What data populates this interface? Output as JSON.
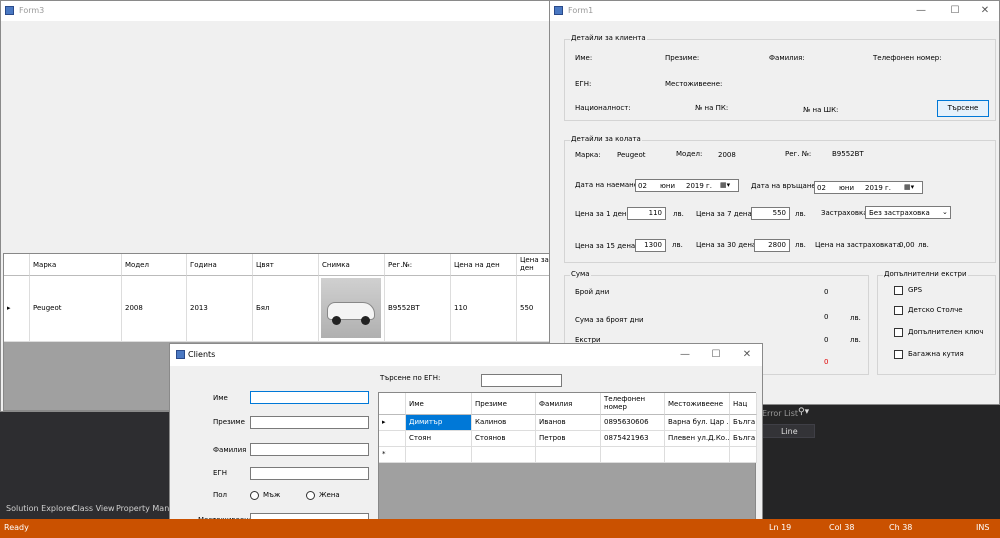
{
  "form3": {
    "title": "Form3",
    "grid": {
      "headers": [
        "Марка",
        "Модел",
        "Година",
        "Цвят",
        "Снимка",
        "Рег.№:",
        "Цена на ден",
        "Цена за ден"
      ],
      "row": [
        "Peugeot",
        "2008",
        "2013",
        "Бял",
        "",
        "B9552BT",
        "110",
        "550"
      ]
    }
  },
  "form1": {
    "title": "Form1",
    "client_group": "Детайли за клиента",
    "labels": {
      "ime": "Име:",
      "prezime": "Презиме:",
      "familia": "Фамилия:",
      "tel": "Телефонен номер:",
      "egn": "ЕГН:",
      "mestozhiveene": "Местоживеене:",
      "nacionalnost": "Националност:",
      "pk": "№ на ПК:",
      "shk": "№ на ШК:"
    },
    "search_button": "Търсене",
    "car_group": "Детайли за колата",
    "car": {
      "marka_label": "Марка:",
      "marka_value": "Peugeot",
      "model_label": "Модел:",
      "model_value": "2008",
      "reg_label": "Рег. №:",
      "reg_value": "B9552BT"
    },
    "dates": {
      "rent_label": "Дата на наемане",
      "rent_day": "02",
      "rent_month": "юни",
      "rent_year": "2019 г.",
      "return_label": "Дата на връщане",
      "return_day": "02",
      "return_month": "юни",
      "return_year": "2019 г."
    },
    "prices": {
      "p1_label": "Цена за 1 ден",
      "p1_value": "110",
      "p7_label": "Цена за 7 дена",
      "p7_value": "550",
      "p15_label": "Цена за 15 дена",
      "p15_value": "1300",
      "p30_label": "Цена за 30 дена",
      "p30_value": "2800",
      "currency": "лв.",
      "insurance_label": "Застраховка",
      "insurance_value": "Без застраховка",
      "insurance_price_label": "Цена на застраховката",
      "insurance_price_value": "0,00",
      "insurance_currency": "лв."
    },
    "sum_group": "Сума",
    "sum": {
      "days_label": "Брой дни",
      "days_value": "0",
      "sum_days_label": "Сума за броят дни",
      "sum_days_value": "0",
      "sum_days_currency": "лв.",
      "extras_label": "Екстри",
      "extras_value": "0",
      "extras_currency": "лв.",
      "total_value": "0"
    },
    "extras_group": "Допълнителни екстри",
    "extras": [
      "GPS",
      "Детско Столче",
      "Допълнителен ключ",
      "Багажна кутия"
    ]
  },
  "clients": {
    "title": "Clients",
    "search_label": "Търсене по ЕГН:",
    "fields": {
      "ime": "Име",
      "prezime": "Презиме",
      "familia": "Фамилия",
      "egn": "ЕГН",
      "pol": "Пол",
      "male": "Мъж",
      "female": "Жена",
      "mestozhiveene": "Местоживеене"
    },
    "grid": {
      "headers": [
        "Име",
        "Презиме",
        "Фамилия",
        "Телефонен номер",
        "Местоживеене",
        "Нац"
      ],
      "rows": [
        [
          "Димитър",
          "Калинов",
          "Иванов",
          "0895630606",
          "Варна бул. Цар ...",
          "Бълга"
        ],
        [
          "Стоян",
          "Стоянов",
          "Петров",
          "0875421963",
          "Плевен ул.Д.Ко...",
          "Бълга"
        ]
      ]
    }
  },
  "ide": {
    "error_list": "Error List",
    "line_header": "Line",
    "tabs": [
      "Solution Explorer",
      "Class View",
      "Property Manag"
    ]
  },
  "status": {
    "ready": "Ready",
    "ln": "Ln 19",
    "col": "Col 38",
    "ch": "Ch 38",
    "ins": "INS"
  },
  "colors": {
    "statusbar": "#ca5100",
    "selected_row": "#0078d7",
    "accent": "#0078d7"
  }
}
